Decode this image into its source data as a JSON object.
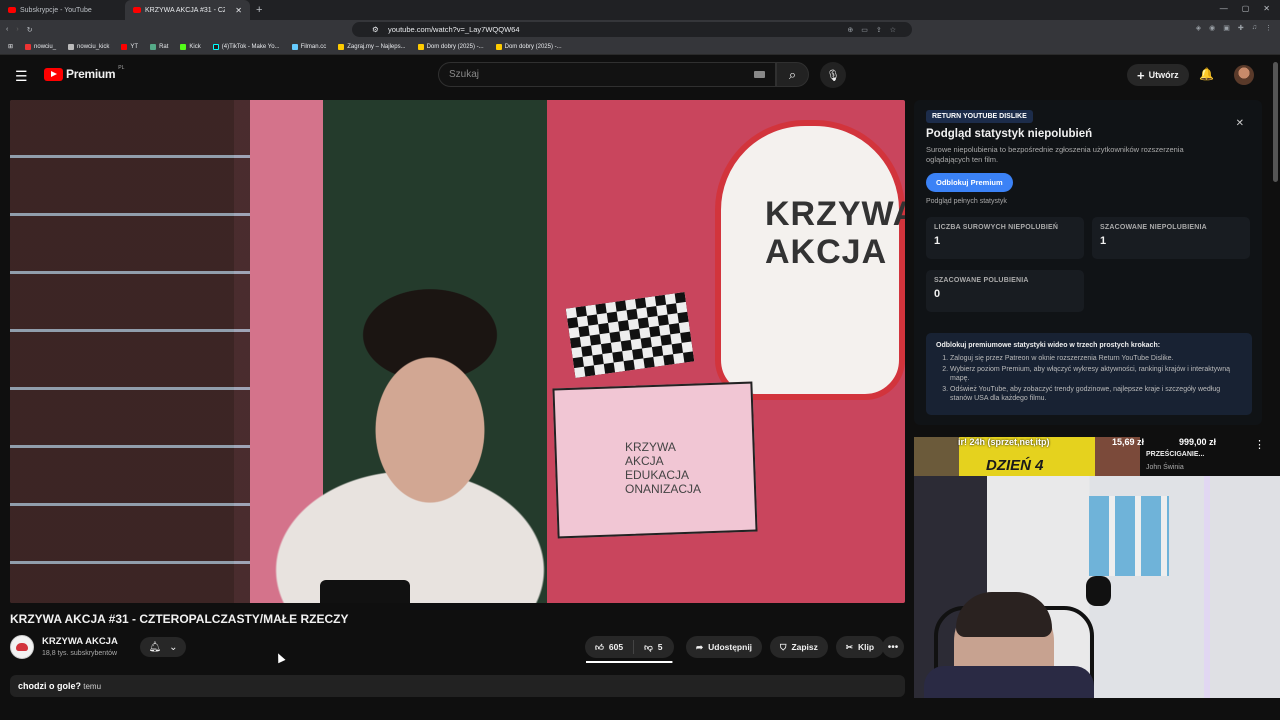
{
  "browser": {
    "tabs": [
      {
        "title": "Subskrypcje - YouTube",
        "active": false
      },
      {
        "title": "KRZYWA AKCJA #31 - CZTEROPALCZASTY/MAŁE RZECZY - YouTube",
        "active": true
      }
    ],
    "new_tab": "+",
    "url": "youtube.com/watch?v=_Lay7WQQW64",
    "bookmarks": [
      "nowciu_",
      "nowciu_kick",
      "YT",
      "Rat",
      "Kick",
      "(4)TikTok - Make Yo...",
      "Filman.cc",
      "Zagraj.my – Najleps...",
      "Dom dobry (2025) -...",
      "Dom dobry (2025) -..."
    ]
  },
  "youtube": {
    "logo": "Premium",
    "logo_country": "PL",
    "search_placeholder": "Szukaj",
    "create_label": "Utwórz"
  },
  "video": {
    "title": "KRZYWA AKCJA #31 - CZTEROPALCZASTY/MAŁE RZECZY",
    "channel": "KRZYWA AKCJA",
    "subscribers": "18,8 tys. subskrybentów",
    "likes": "605",
    "dislikes": "5",
    "share_label": "Udostępnij",
    "save_label": "Zapisz",
    "clip_label": "Klip",
    "description_overlay": "chodzi o gole?",
    "description_tail": "temu",
    "heart_text_line1": "KRZYWA",
    "heart_text_line2": "AKCJA",
    "clapper_line1": "KRZYWA",
    "clapper_line2": "AKCJA",
    "clapper_line3": "EDUKACJA",
    "clapper_line4": "ONANIZACJA"
  },
  "ryd": {
    "badge": "RETURN YOUTUBE DISLIKE",
    "title": "Podgląd statystyk niepolubień",
    "description": "Surowe niepolubienia to bezpośrednie zgłoszenia użytkowników rozszerzenia oglądających ten film.",
    "unlock_button": "Odblokuj Premium",
    "preview_note": "Podgląd pełnych statystyk",
    "stats": [
      {
        "label": "LICZBA SUROWYCH NIEPOLUBIEŃ",
        "value": "1"
      },
      {
        "label": "SZACOWANE NIEPOLUBIENIA",
        "value": "1"
      },
      {
        "label": "SZACOWANE POLUBIENIA",
        "value": "0"
      }
    ],
    "steps_heading": "Odblokuj premiumowe statystyki wideo w trzech prostych krokach:",
    "steps": [
      "Zaloguj się przez Patreon w oknie rozszerzenia Return YouTube Dislike.",
      "Wybierz poziom Premium, aby włączyć wykresy aktywności, rankingi krajów i interaktywną mapę.",
      "Odśwież YouTube, aby zobaczyć trendy godzinowe, najlepsze kraje i szczegóły według stanów USA dla każdego filmu."
    ]
  },
  "recommendation": {
    "overlay_text": "ir! 24h (sprzet,net,itp)",
    "price1": "15,69 zł",
    "price2": "999,00 zł",
    "big_text": "DZIEŃ 4",
    "title": "PRZEŚCIGANIE...",
    "channel": "John Świnia"
  }
}
